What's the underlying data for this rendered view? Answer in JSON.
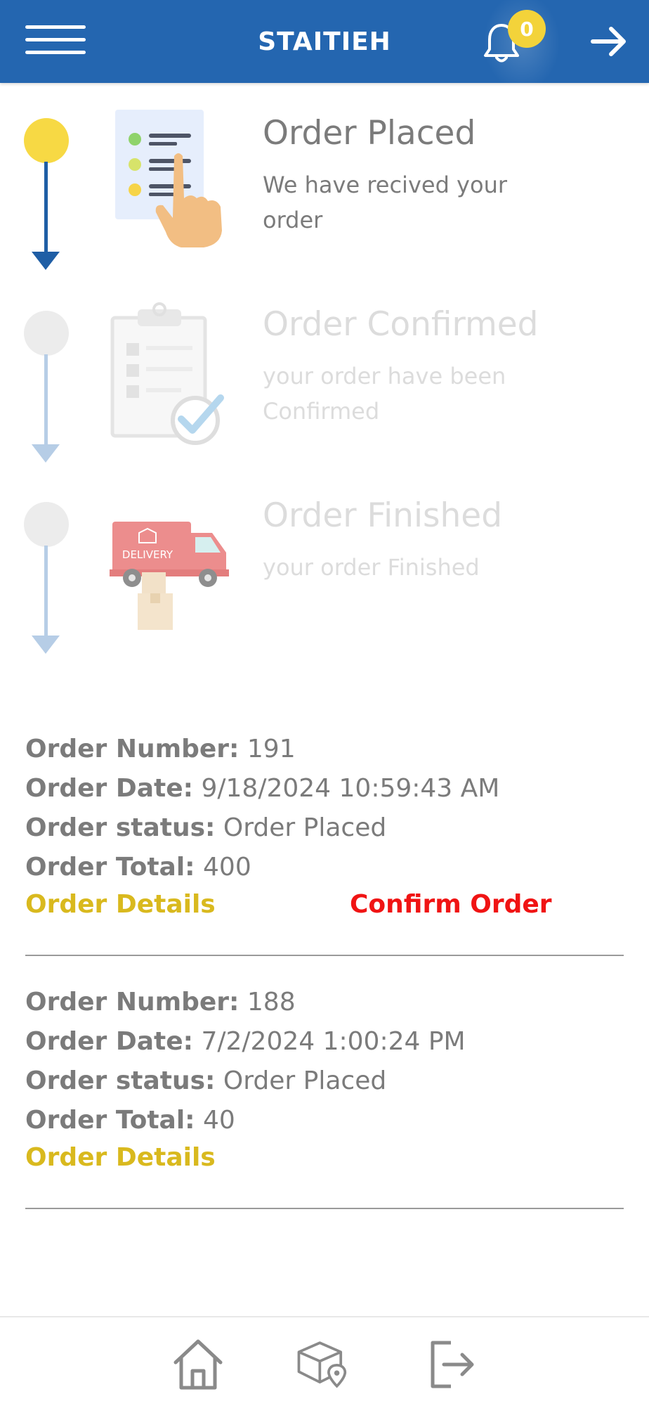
{
  "header": {
    "title": "STAITIEH",
    "notification_count": "0"
  },
  "steps": [
    {
      "title": "Order Placed",
      "description": "We have recived your order",
      "state": "active"
    },
    {
      "title": "Order Confirmed",
      "description": "your order have been Confirmed",
      "state": "inactive"
    },
    {
      "title": "Order Finished",
      "description": "your order Finished",
      "state": "inactive",
      "illustration_text": "DELIVERY"
    }
  ],
  "labels": {
    "order_number": "Order Number:",
    "order_date": "Order Date:",
    "order_status": "Order status:",
    "order_total": "Order Total:"
  },
  "orders": [
    {
      "number": "191",
      "date": "9/18/2024 10:59:43 AM",
      "status": "Order Placed",
      "total": "400",
      "details_label": "Order Details",
      "confirm_label": "Confirm Order"
    },
    {
      "number": "188",
      "date": "7/2/2024 1:00:24 PM",
      "status": "Order Placed",
      "total": "40",
      "details_label": "Order Details"
    }
  ],
  "bottom_nav": [
    {
      "icon": "home-icon"
    },
    {
      "icon": "package-location-icon"
    },
    {
      "icon": "logout-icon"
    }
  ],
  "colors": {
    "header_bg": "#2466b0",
    "badge": "#f3d33a",
    "active_dot": "#f7d944",
    "details_link": "#d9b91e",
    "confirm_link": "#f01414"
  }
}
